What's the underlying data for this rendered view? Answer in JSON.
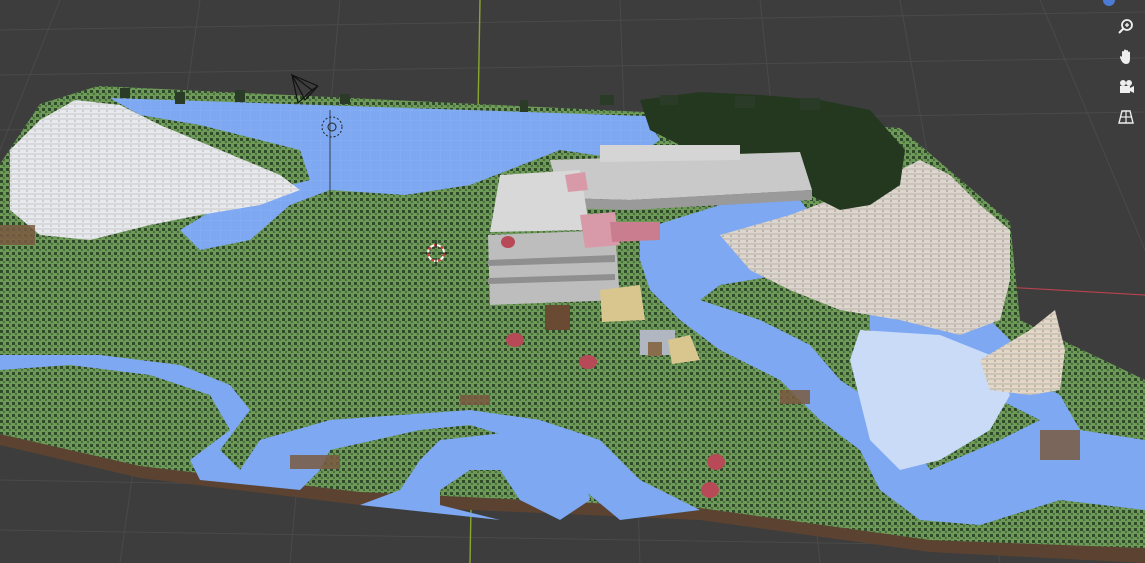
{
  "app": {
    "viewport_mode": "3D Viewport"
  },
  "colors": {
    "background": "#3d3d3d",
    "grid_line": "#4a4a4a",
    "x_axis": "#b8434d",
    "y_axis": "#8aa631",
    "water": "#7ea8f2",
    "grass": "#6e9a58",
    "forest": "#2f4a2a",
    "snow": "#e6e9ee",
    "stone": "#b9b9b9",
    "dirt": "#6b4a34",
    "sand": "#d9c68e",
    "ice": "#c9dbf7"
  },
  "navigation": {
    "buttons": [
      {
        "icon": "zoom-icon"
      },
      {
        "icon": "hand-pan-icon"
      },
      {
        "icon": "camera-icon"
      },
      {
        "icon": "perspective-grid-icon"
      }
    ]
  },
  "scene_objects": [
    {
      "name": "camera-object",
      "icon": "camera-wireframe-icon"
    },
    {
      "name": "light-object",
      "icon": "light-icon"
    },
    {
      "name": "3d-cursor",
      "icon": "cursor-icon"
    },
    {
      "name": "voxel-terrain-mesh",
      "icon": "terrain-mesh"
    }
  ]
}
